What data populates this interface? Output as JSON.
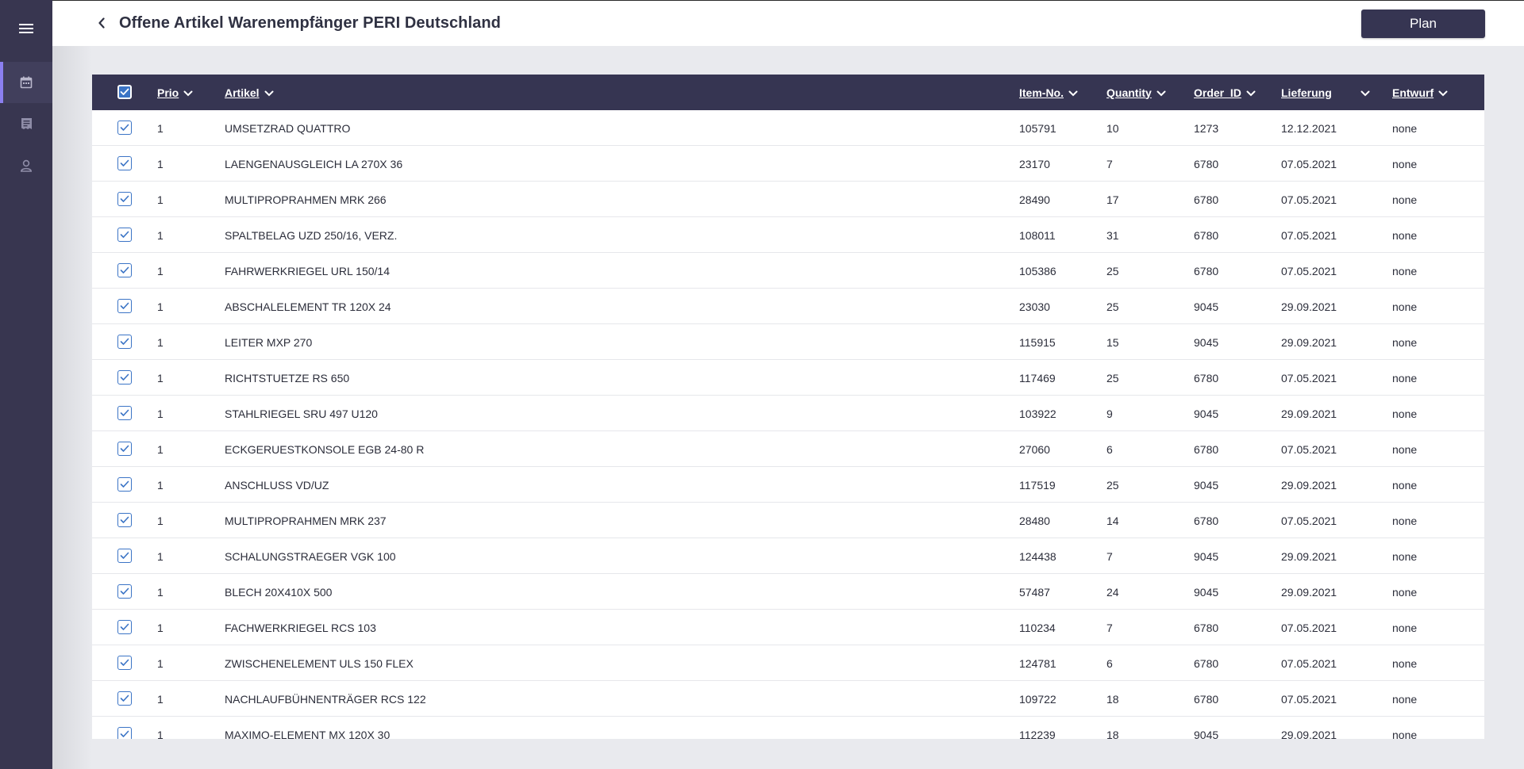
{
  "header": {
    "title": "Offene Artikel Warenempfänger PERI Deutschland",
    "plan_label": "Plan"
  },
  "sidebar": {
    "items": [
      {
        "icon": "menu-icon"
      },
      {
        "icon": "calendar-icon",
        "active": true
      },
      {
        "icon": "receipt-icon"
      },
      {
        "icon": "user-icon"
      }
    ]
  },
  "table": {
    "columns": [
      "Prio",
      "Artikel",
      "Item-No.",
      "Quantity",
      "Order_ID",
      "Lieferung",
      "Entwurf"
    ],
    "rows": [
      [
        "1",
        "UMSETZRAD QUATTRO",
        "105791",
        "10",
        "1273",
        "12.12.2021",
        "none"
      ],
      [
        "1",
        "LAENGENAUSGLEICH LA 270X 36",
        "23170",
        "7",
        "6780",
        "07.05.2021",
        "none"
      ],
      [
        "1",
        "MULTIPROPRAHMEN MRK 266",
        "28490",
        "17",
        "6780",
        "07.05.2021",
        "none"
      ],
      [
        "1",
        "SPALTBELAG UZD 250/16, VERZ.",
        "108011",
        "31",
        "6780",
        "07.05.2021",
        "none"
      ],
      [
        "1",
        "FAHRWERKRIEGEL URL 150/14",
        "105386",
        "25",
        "6780",
        "07.05.2021",
        "none"
      ],
      [
        "1",
        "ABSCHALELEMENT TR 120X 24",
        "23030",
        "25",
        "9045",
        "29.09.2021",
        "none"
      ],
      [
        "1",
        "LEITER MXP 270",
        "115915",
        "15",
        "9045",
        "29.09.2021",
        "none"
      ],
      [
        "1",
        "RICHTSTUETZE RS 650",
        "117469",
        "25",
        "6780",
        "07.05.2021",
        "none"
      ],
      [
        "1",
        "STAHLRIEGEL SRU 497 U120",
        "103922",
        "9",
        "9045",
        "29.09.2021",
        "none"
      ],
      [
        "1",
        "ECKGERUESTKONSOLE EGB 24-80 R",
        "27060",
        "6",
        "6780",
        "07.05.2021",
        "none"
      ],
      [
        "1",
        "ANSCHLUSS VD/UZ",
        "117519",
        "25",
        "9045",
        "29.09.2021",
        "none"
      ],
      [
        "1",
        "MULTIPROPRAHMEN MRK 237",
        "28480",
        "14",
        "6780",
        "07.05.2021",
        "none"
      ],
      [
        "1",
        "SCHALUNGSTRAEGER VGK 100",
        "124438",
        "7",
        "9045",
        "29.09.2021",
        "none"
      ],
      [
        "1",
        "BLECH 20X410X 500",
        "57487",
        "24",
        "9045",
        "29.09.2021",
        "none"
      ],
      [
        "1",
        "FACHWERKRIEGEL RCS 103",
        "110234",
        "7",
        "6780",
        "07.05.2021",
        "none"
      ],
      [
        "1",
        "ZWISCHENELEMENT ULS 150 FLEX",
        "124781",
        "6",
        "6780",
        "07.05.2021",
        "none"
      ],
      [
        "1",
        "NACHLAUFBÜHNENTRÄGER RCS 122",
        "109722",
        "18",
        "6780",
        "07.05.2021",
        "none"
      ],
      [
        "1",
        "MAXIMO-ELEMENT MX 120X 30",
        "112239",
        "18",
        "9045",
        "29.09.2021",
        "none"
      ]
    ]
  }
}
